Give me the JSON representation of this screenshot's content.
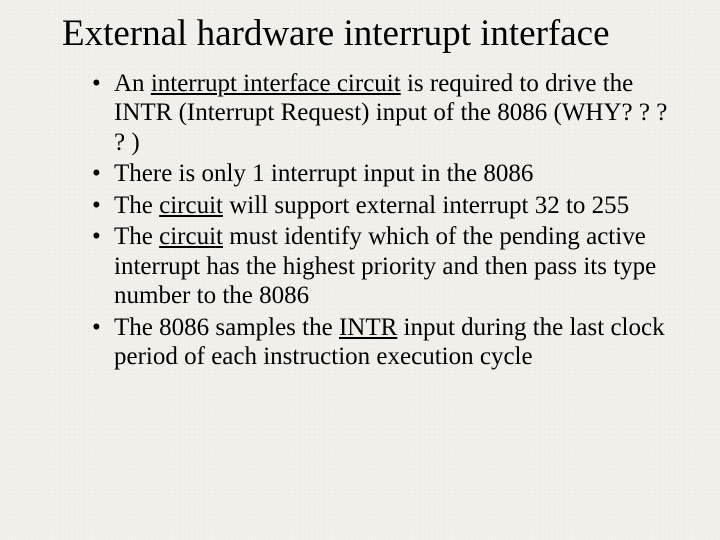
{
  "title": "External hardware interrupt interface",
  "bullets": [
    {
      "pre": "An ",
      "u": "interrupt interface circuit",
      "post": " is required to drive the INTR (Interrupt Request) input of the 8086 (WHY? ? ? ? )"
    },
    {
      "pre": "There is only 1 interrupt input in the 8086",
      "u": "",
      "post": ""
    },
    {
      "pre": "The ",
      "u": "circuit",
      "post": " will support external interrupt 32 to 255"
    },
    {
      "pre": "The ",
      "u": "circuit",
      "post": " must identify which of the pending active interrupt has the highest priority and then pass its type number to the 8086"
    },
    {
      "pre": "The 8086 samples the ",
      "u": "INTR",
      "post": " input during the last clock period of each instruction execution cycle"
    }
  ]
}
